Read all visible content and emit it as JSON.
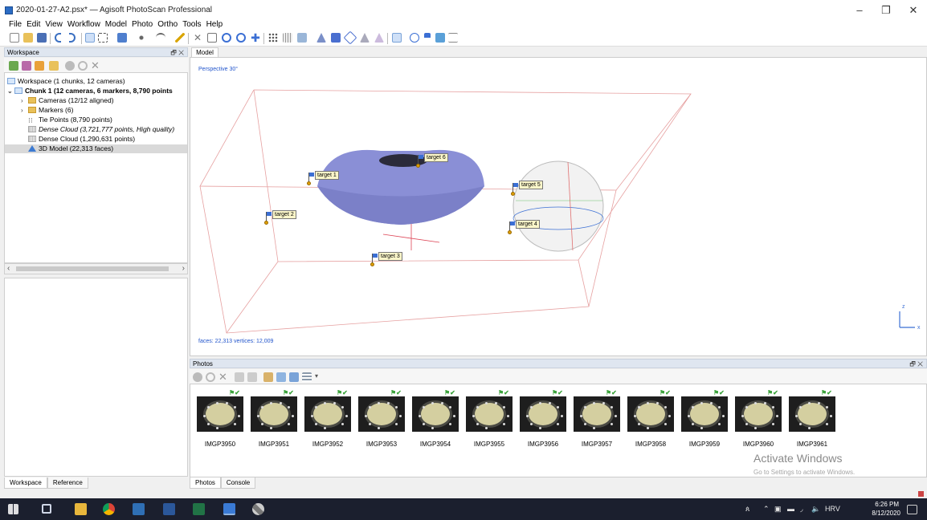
{
  "window": {
    "title": "2020-01-27-A2.psx* — Agisoft PhotoScan Professional",
    "minimize": "–",
    "restore": "❐",
    "close": "✕"
  },
  "menu": [
    "File",
    "Edit",
    "View",
    "Workflow",
    "Model",
    "Photo",
    "Ortho",
    "Tools",
    "Help"
  ],
  "workspace": {
    "title": "Workspace",
    "panel_controls": "🗗 ✕",
    "tree": [
      {
        "label": "Workspace (1 chunks, 12 cameras)",
        "icon": "workspace-icon",
        "indent": 0,
        "chevron": ""
      },
      {
        "label": "Chunk 1 (12 cameras, 6 markers, 8,790 points",
        "icon": "chunk-icon",
        "indent": 0,
        "chevron": "⌄",
        "bold": true
      },
      {
        "label": "Cameras (12/12 aligned)",
        "icon": "folder-icon",
        "indent": 1,
        "chevron": "›"
      },
      {
        "label": "Markers (6)",
        "icon": "folder-icon",
        "indent": 1,
        "chevron": "›"
      },
      {
        "label": "Tie Points (8,790 points)",
        "icon": "tie-points-icon",
        "indent": 1,
        "chevron": ""
      },
      {
        "label": "Dense Cloud (3,721,777 points, High quality)",
        "icon": "dense-cloud-icon",
        "indent": 1,
        "chevron": "",
        "italic": true
      },
      {
        "label": "Dense Cloud (1,290,631 points)",
        "icon": "dense-cloud-icon",
        "indent": 1,
        "chevron": ""
      },
      {
        "label": "3D Model (22,313 faces)",
        "icon": "model-icon",
        "indent": 1,
        "chevron": "",
        "selected": true
      }
    ],
    "tabs": [
      "Workspace",
      "Reference"
    ]
  },
  "model": {
    "tab": "Model",
    "perspective": "Perspective 30°",
    "stats": "faces: 22,313 vertices: 12,009",
    "markers": [
      "target 1",
      "target 2",
      "target 3",
      "target 4",
      "target 5",
      "target 6"
    ],
    "axis_z": "z",
    "axis_x": "x"
  },
  "photos": {
    "title": "Photos",
    "panel_controls": "🗗 ✕",
    "items": [
      "IMGP3950",
      "IMGP3951",
      "IMGP3952",
      "IMGP3953",
      "IMGP3954",
      "IMGP3955",
      "IMGP3956",
      "IMGP3957",
      "IMGP3958",
      "IMGP3959",
      "IMGP3960",
      "IMGP3961"
    ],
    "tabs": [
      "Photos",
      "Console"
    ]
  },
  "watermark": {
    "line1": "Activate Windows",
    "line2": "Go to Settings to activate Windows."
  },
  "taskbar": {
    "lang": "HRV",
    "time": "6:26 PM",
    "date": "8/12/2020"
  },
  "colors": {
    "model_surface": "#8a8fd6",
    "bbox_red": "#e07070",
    "marker_label_bg": "#fbf6c9",
    "accent_blue": "#2255cc"
  }
}
